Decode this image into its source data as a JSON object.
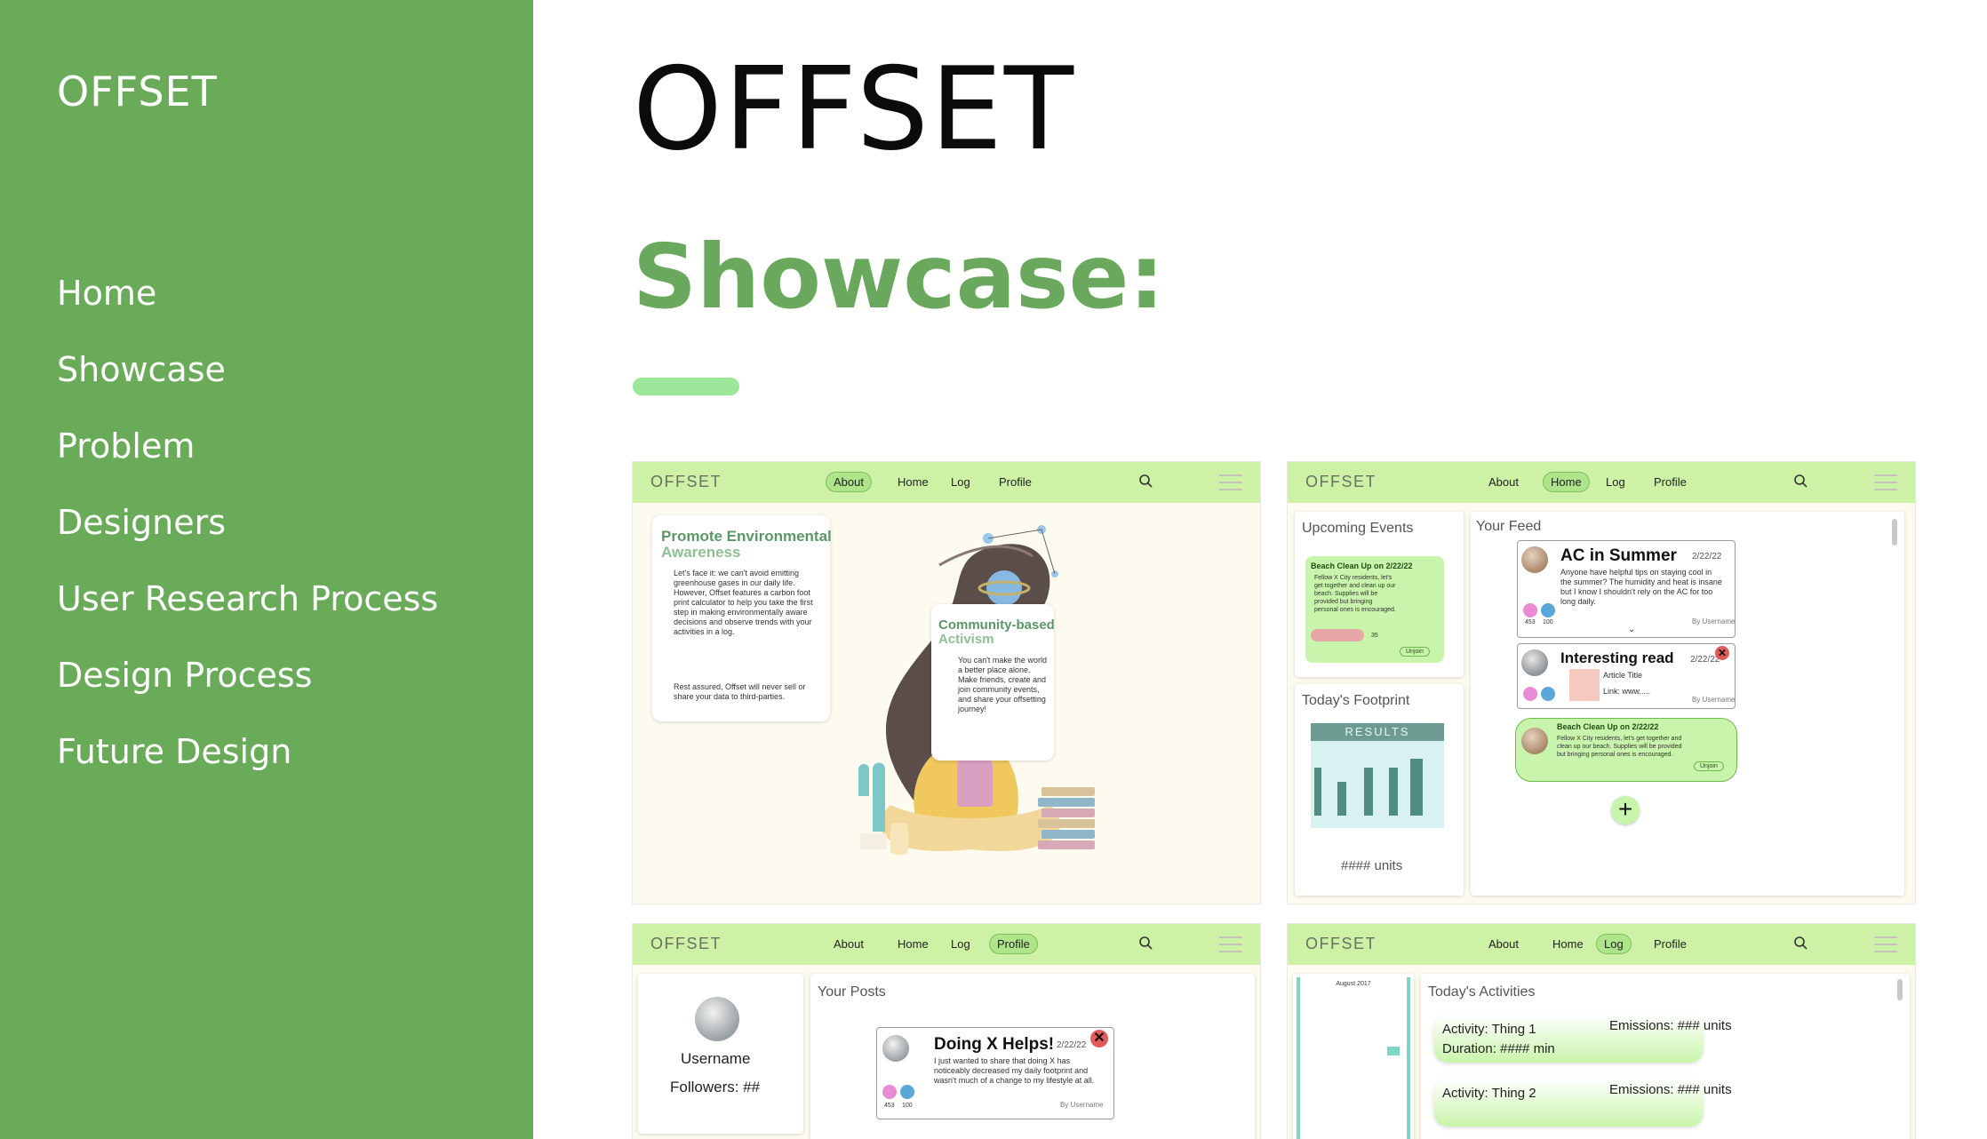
{
  "sidebar": {
    "brand": "OFFSET",
    "nav": [
      "Home",
      "Showcase",
      "Problem",
      "Designers",
      "User Research Process",
      "Design Process",
      "Future Design"
    ]
  },
  "main": {
    "title": "OFFSET",
    "section_title": "Showcase:"
  },
  "colors": {
    "sidebar": "#69ab58",
    "accent": "#6aa95d",
    "accent_bar": "#9ee79a",
    "mock_header": "#cdf2a6"
  },
  "mock_nav": [
    "About",
    "Home",
    "Log",
    "Profile"
  ],
  "mock_logo": "OFFSET",
  "screen_about": {
    "active": "About",
    "card1_title": "Promote Environmental",
    "card1_title2": "Awareness",
    "card1_body": "Let's face it: we can't avoid emitting greenhouse gases in our daily life. However, Offset features a carbon foot print calculator to help you take the first step in making environmentally aware decisions and observe trends with your activities in a log.",
    "card1_body2": "Rest assured, Offset will never sell or share your data to third-parties.",
    "card2_title": "Community-based",
    "card2_title2": "Activism",
    "card2_body": "You can't make the world a better place alone. Make friends, create and join community events, and share your offsetting journey!"
  },
  "screen_home": {
    "active": "Home",
    "upcoming_title": "Upcoming Events",
    "event_title": "Beach Clean Up on 2/22/22",
    "event_body": "Fellow X City residents, let's get together and clean up our beach. Supplies will be provided but bringing personal ones is encouraged.",
    "event_count": "35",
    "event_btn": "Unjoin",
    "footprint_title": "Today's Footprint",
    "results_label": "RESULTS",
    "units": "#### units",
    "feed_title": "Your Feed",
    "post1_title": "AC in Summer",
    "post1_date": "2/22/22",
    "post1_body": "Anyone have helpful tips on staying cool in the summer? The humidity and heat is insane but I know I shouldn't rely on the AC for too long daily.",
    "post1_by": "By Username",
    "likes": "453",
    "comments": "100",
    "post2_title": "Interesting read",
    "post2_date": "2/22/22",
    "post2_article": "Article Title",
    "post2_link": "Link: www.....",
    "post2_by": "By Username",
    "post3_title": "Beach Clean Up on 2/22/22",
    "post3_body": "Fellow X City residents, let's get together and clean up our beach. Supplies will be provided but bringing personal ones is encouraged.",
    "post3_btn": "Unjoin",
    "add_symbol": "+"
  },
  "screen_profile": {
    "active": "Profile",
    "username": "Username",
    "followers": "Followers: ##",
    "posts_title": "Your Posts",
    "post_title": "Doing X Helps!",
    "post_date": "2/22/22",
    "post_body": "I just wanted to share that doing X has noticeably decreased my daily footprint and wasn't much of a change to my lifestyle at all.",
    "post_by": "By Username",
    "likes": "453",
    "comments": "100"
  },
  "screen_log": {
    "active": "Log",
    "calendar_month": "August 2017",
    "activities_title": "Today's Activities",
    "activity1": "Activity: Thing 1",
    "emissions1": "Emissions: ### units",
    "duration1": "Duration: #### min",
    "activity2": "Activity: Thing 2",
    "emissions2": "Emissions: ### units"
  }
}
